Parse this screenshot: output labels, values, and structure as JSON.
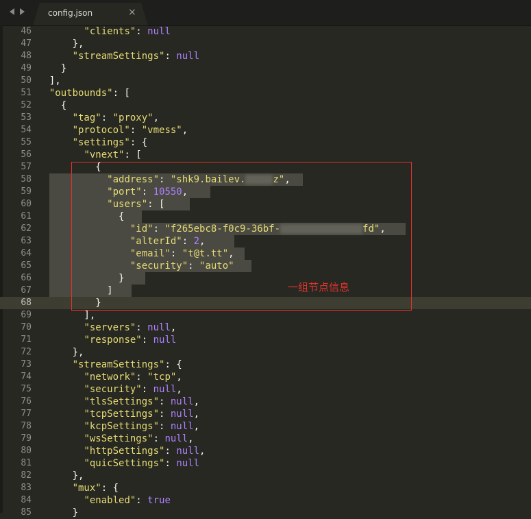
{
  "tab": {
    "title": "config.json",
    "close_glyph": "×"
  },
  "annotation": {
    "label": "一组节点信息"
  },
  "editor": {
    "lines": [
      {
        "num": "46",
        "indent": "        ",
        "parts": [
          [
            "s",
            "\"clients\""
          ],
          [
            "p",
            ": "
          ],
          [
            "n",
            "null"
          ]
        ]
      },
      {
        "num": "47",
        "indent": "      ",
        "parts": [
          [
            "p",
            "},"
          ]
        ]
      },
      {
        "num": "48",
        "indent": "      ",
        "parts": [
          [
            "s",
            "\"streamSettings\""
          ],
          [
            "p",
            ": "
          ],
          [
            "n",
            "null"
          ]
        ]
      },
      {
        "num": "49",
        "indent": "    ",
        "parts": [
          [
            "p",
            "}"
          ]
        ]
      },
      {
        "num": "50",
        "indent": "  ",
        "parts": [
          [
            "p",
            "],"
          ]
        ]
      },
      {
        "num": "51",
        "indent": "  ",
        "parts": [
          [
            "s",
            "\"outbounds\""
          ],
          [
            "p",
            ": ["
          ]
        ]
      },
      {
        "num": "52",
        "indent": "    ",
        "parts": [
          [
            "p",
            "{"
          ]
        ]
      },
      {
        "num": "53",
        "indent": "      ",
        "parts": [
          [
            "s",
            "\"tag\""
          ],
          [
            "p",
            ": "
          ],
          [
            "s",
            "\"proxy\""
          ],
          [
            "p",
            ","
          ]
        ]
      },
      {
        "num": "54",
        "indent": "      ",
        "parts": [
          [
            "s",
            "\"protocol\""
          ],
          [
            "p",
            ": "
          ],
          [
            "s",
            "\"vmess\""
          ],
          [
            "p",
            ","
          ]
        ]
      },
      {
        "num": "55",
        "indent": "      ",
        "parts": [
          [
            "s",
            "\"settings\""
          ],
          [
            "p",
            ": {"
          ]
        ]
      },
      {
        "num": "56",
        "indent": "        ",
        "parts": [
          [
            "s",
            "\"vnext\""
          ],
          [
            "p",
            ": ["
          ]
        ]
      },
      {
        "num": "57",
        "indent": "          ",
        "parts": [
          [
            "p",
            "{"
          ]
        ]
      },
      {
        "num": "58",
        "indent": "            ",
        "parts": [
          [
            "s",
            "\"address\""
          ],
          [
            "p",
            ": "
          ],
          [
            "s",
            "\"shk9.bailev."
          ],
          [
            "blur",
            "40"
          ],
          [
            "s",
            "z\""
          ],
          [
            "p",
            ","
          ]
        ]
      },
      {
        "num": "59",
        "indent": "            ",
        "parts": [
          [
            "s",
            "\"port\""
          ],
          [
            "p",
            ": "
          ],
          [
            "n",
            "10550"
          ],
          [
            "p",
            ","
          ]
        ]
      },
      {
        "num": "60",
        "indent": "            ",
        "parts": [
          [
            "s",
            "\"users\""
          ],
          [
            "p",
            ": ["
          ]
        ]
      },
      {
        "num": "61",
        "indent": "              ",
        "parts": [
          [
            "p",
            "{"
          ]
        ]
      },
      {
        "num": "62",
        "indent": "                ",
        "parts": [
          [
            "s",
            "\"id\""
          ],
          [
            "p",
            ": "
          ],
          [
            "s",
            "\"f265ebc8-f0c9-36bf-"
          ],
          [
            "blur",
            "120"
          ],
          [
            "s",
            "fd\""
          ],
          [
            "p",
            ","
          ]
        ]
      },
      {
        "num": "63",
        "indent": "                ",
        "parts": [
          [
            "s",
            "\"alterId\""
          ],
          [
            "p",
            ": "
          ],
          [
            "n",
            "2"
          ],
          [
            "p",
            ","
          ]
        ]
      },
      {
        "num": "64",
        "indent": "                ",
        "parts": [
          [
            "s",
            "\"email\""
          ],
          [
            "p",
            ": "
          ],
          [
            "s",
            "\"t@t.tt\""
          ],
          [
            "p",
            ","
          ]
        ]
      },
      {
        "num": "65",
        "indent": "                ",
        "parts": [
          [
            "s",
            "\"security\""
          ],
          [
            "p",
            ": "
          ],
          [
            "s",
            "\"auto\""
          ]
        ]
      },
      {
        "num": "66",
        "indent": "              ",
        "parts": [
          [
            "p",
            "}"
          ]
        ]
      },
      {
        "num": "67",
        "indent": "            ",
        "parts": [
          [
            "p",
            "]"
          ]
        ]
      },
      {
        "num": "68",
        "indent": "          ",
        "parts": [
          [
            "p",
            "}"
          ]
        ],
        "current": true
      },
      {
        "num": "69",
        "indent": "        ",
        "parts": [
          [
            "p",
            "],"
          ]
        ]
      },
      {
        "num": "70",
        "indent": "        ",
        "parts": [
          [
            "s",
            "\"servers\""
          ],
          [
            "p",
            ": "
          ],
          [
            "n",
            "null"
          ],
          [
            "p",
            ","
          ]
        ]
      },
      {
        "num": "71",
        "indent": "        ",
        "parts": [
          [
            "s",
            "\"response\""
          ],
          [
            "p",
            ": "
          ],
          [
            "n",
            "null"
          ]
        ]
      },
      {
        "num": "72",
        "indent": "      ",
        "parts": [
          [
            "p",
            "},"
          ]
        ]
      },
      {
        "num": "73",
        "indent": "      ",
        "parts": [
          [
            "s",
            "\"streamSettings\""
          ],
          [
            "p",
            ": {"
          ]
        ]
      },
      {
        "num": "74",
        "indent": "        ",
        "parts": [
          [
            "s",
            "\"network\""
          ],
          [
            "p",
            ": "
          ],
          [
            "s",
            "\"tcp\""
          ],
          [
            "p",
            ","
          ]
        ]
      },
      {
        "num": "75",
        "indent": "        ",
        "parts": [
          [
            "s",
            "\"security\""
          ],
          [
            "p",
            ": "
          ],
          [
            "n",
            "null"
          ],
          [
            "p",
            ","
          ]
        ]
      },
      {
        "num": "76",
        "indent": "        ",
        "parts": [
          [
            "s",
            "\"tlsSettings\""
          ],
          [
            "p",
            ": "
          ],
          [
            "n",
            "null"
          ],
          [
            "p",
            ","
          ]
        ]
      },
      {
        "num": "77",
        "indent": "        ",
        "parts": [
          [
            "s",
            "\"tcpSettings\""
          ],
          [
            "p",
            ": "
          ],
          [
            "n",
            "null"
          ],
          [
            "p",
            ","
          ]
        ]
      },
      {
        "num": "78",
        "indent": "        ",
        "parts": [
          [
            "s",
            "\"kcpSettings\""
          ],
          [
            "p",
            ": "
          ],
          [
            "n",
            "null"
          ],
          [
            "p",
            ","
          ]
        ]
      },
      {
        "num": "79",
        "indent": "        ",
        "parts": [
          [
            "s",
            "\"wsSettings\""
          ],
          [
            "p",
            ": "
          ],
          [
            "n",
            "null"
          ],
          [
            "p",
            ","
          ]
        ]
      },
      {
        "num": "80",
        "indent": "        ",
        "parts": [
          [
            "s",
            "\"httpSettings\""
          ],
          [
            "p",
            ": "
          ],
          [
            "n",
            "null"
          ],
          [
            "p",
            ","
          ]
        ]
      },
      {
        "num": "81",
        "indent": "        ",
        "parts": [
          [
            "s",
            "\"quicSettings\""
          ],
          [
            "p",
            ": "
          ],
          [
            "n",
            "null"
          ]
        ]
      },
      {
        "num": "82",
        "indent": "      ",
        "parts": [
          [
            "p",
            "},"
          ]
        ]
      },
      {
        "num": "83",
        "indent": "      ",
        "parts": [
          [
            "s",
            "\"mux\""
          ],
          [
            "p",
            ": {"
          ]
        ]
      },
      {
        "num": "84",
        "indent": "        ",
        "parts": [
          [
            "s",
            "\"enabled\""
          ],
          [
            "p",
            ": "
          ],
          [
            "n",
            "true"
          ]
        ]
      },
      {
        "num": "85",
        "indent": "      ",
        "parts": [
          [
            "p",
            "}"
          ]
        ]
      }
    ]
  },
  "colors": {
    "background": "#272822",
    "string": "#e6db74",
    "constant": "#ae81ff",
    "plain": "#f8f8f2",
    "gutter": "#90908a",
    "annotation": "#e0322b"
  }
}
